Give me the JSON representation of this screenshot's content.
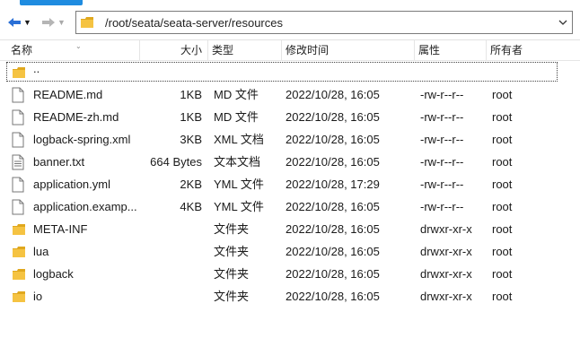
{
  "nav": {
    "back_icon": "back-arrow-icon",
    "forward_icon": "forward-arrow-icon",
    "path": "/root/seata/seata-server/resources"
  },
  "columns": {
    "name": "名称",
    "size": "大小",
    "type": "类型",
    "modified": "修改时间",
    "attributes": "属性",
    "owner": "所有者"
  },
  "parent_row": {
    "name": ".."
  },
  "files": [
    {
      "name": "README.md",
      "size": "1KB",
      "type": "MD 文件",
      "modified": "2022/10/28, 16:05",
      "attrs": "-rw-r--r--",
      "owner": "root",
      "icon": "file-icon"
    },
    {
      "name": "README-zh.md",
      "size": "1KB",
      "type": "MD 文件",
      "modified": "2022/10/28, 16:05",
      "attrs": "-rw-r--r--",
      "owner": "root",
      "icon": "file-icon"
    },
    {
      "name": "logback-spring.xml",
      "size": "3KB",
      "type": "XML 文档",
      "modified": "2022/10/28, 16:05",
      "attrs": "-rw-r--r--",
      "owner": "root",
      "icon": "file-icon"
    },
    {
      "name": "banner.txt",
      "size": "664 Bytes",
      "type": "文本文档",
      "modified": "2022/10/28, 16:05",
      "attrs": "-rw-r--r--",
      "owner": "root",
      "icon": "text-file-icon"
    },
    {
      "name": "application.yml",
      "size": "2KB",
      "type": "YML 文件",
      "modified": "2022/10/28, 17:29",
      "attrs": "-rw-r--r--",
      "owner": "root",
      "icon": "file-icon"
    },
    {
      "name": "application.examp...",
      "size": "4KB",
      "type": "YML 文件",
      "modified": "2022/10/28, 16:05",
      "attrs": "-rw-r--r--",
      "owner": "root",
      "icon": "file-icon"
    },
    {
      "name": "META-INF",
      "size": "",
      "type": "文件夹",
      "modified": "2022/10/28, 16:05",
      "attrs": "drwxr-xr-x",
      "owner": "root",
      "icon": "folder-icon"
    },
    {
      "name": "lua",
      "size": "",
      "type": "文件夹",
      "modified": "2022/10/28, 16:05",
      "attrs": "drwxr-xr-x",
      "owner": "root",
      "icon": "folder-icon"
    },
    {
      "name": "logback",
      "size": "",
      "type": "文件夹",
      "modified": "2022/10/28, 16:05",
      "attrs": "drwxr-xr-x",
      "owner": "root",
      "icon": "folder-icon"
    },
    {
      "name": "io",
      "size": "",
      "type": "文件夹",
      "modified": "2022/10/28, 16:05",
      "attrs": "drwxr-xr-x",
      "owner": "root",
      "icon": "folder-icon"
    }
  ],
  "colors": {
    "accent": "#1f8ce0",
    "folder": "#f5c342",
    "folder_dark": "#e0a81e"
  }
}
